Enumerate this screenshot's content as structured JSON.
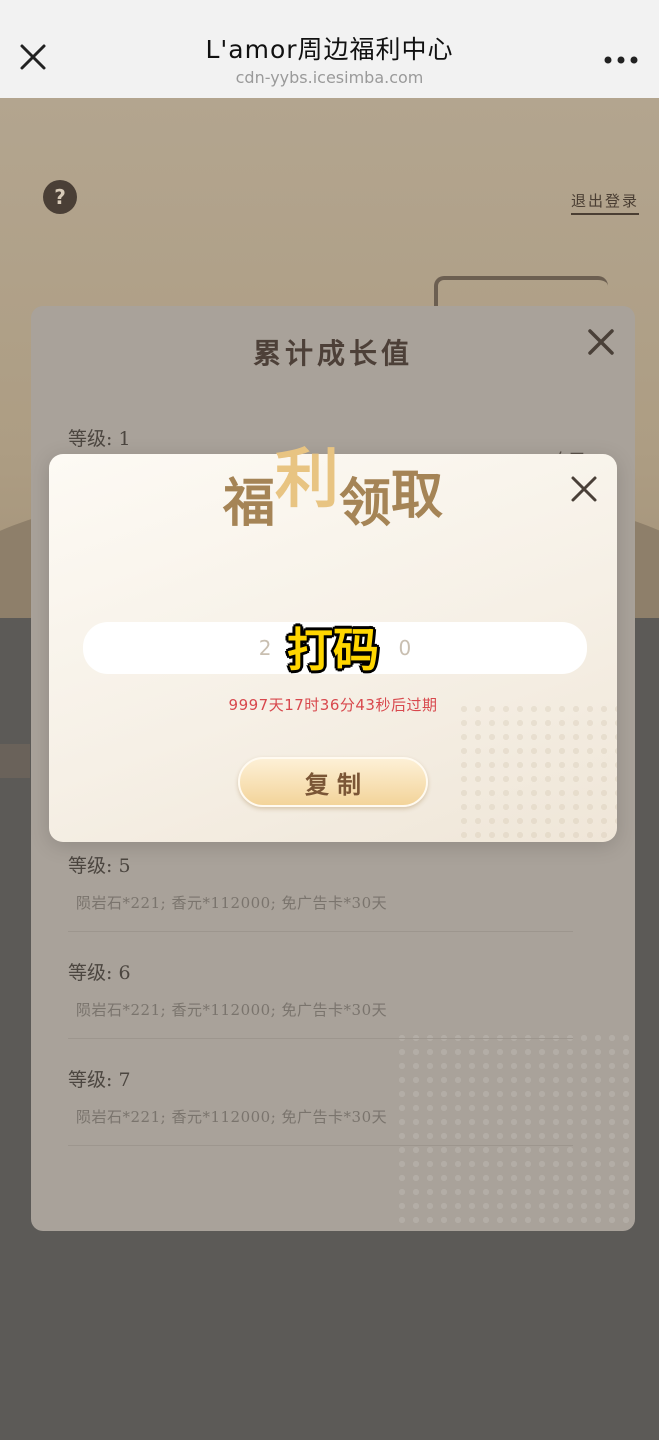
{
  "nav": {
    "title": "L'amor周边福利中心",
    "url": "cdn-yybs.icesimba.com"
  },
  "background": {
    "help_symbol": "?",
    "logout_label": "退出登录"
  },
  "growth_panel": {
    "title": "累计成长值",
    "first_level": "等级: 1",
    "side_label": "白天",
    "levels": [
      {
        "label": "等级: 5",
        "rewards": "陨岩石*221; 香元*112000; 免广告卡*30天"
      },
      {
        "label": "等级: 6",
        "rewards": "陨岩石*221; 香元*112000; 免广告卡*30天"
      },
      {
        "label": "等级: 7",
        "rewards": "陨岩石*221; 香元*112000; 免广告卡*30天"
      }
    ]
  },
  "claim_modal": {
    "title_chars": [
      "福",
      "利",
      "领",
      "取"
    ],
    "code_value": "2                    0",
    "redaction_label": "打码",
    "expiry": "9997天17时36分43秒后过期",
    "copy_label": "复制"
  },
  "colors": {
    "accent_gold": "#e8c482",
    "title_brown": "#a58456",
    "expiry_red": "#d8484d",
    "button_gold": "#f3d49a"
  },
  "icons": [
    "close-icon",
    "more-icon",
    "help-icon",
    "modal-close-icon"
  ]
}
